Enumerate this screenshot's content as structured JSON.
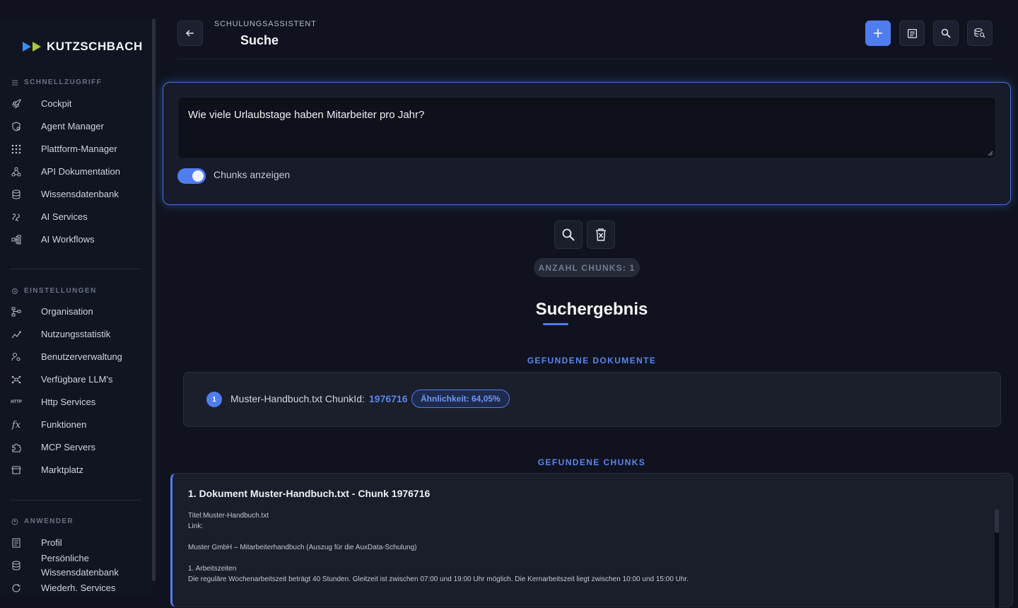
{
  "brand": {
    "name": "KUTZSCHBACH",
    "colors": {
      "accent": "#4f7df0",
      "logo_blue": "#3b8df0",
      "logo_green": "#a9c93a"
    }
  },
  "sidebar": {
    "sections": [
      {
        "title": "SCHNELLZUGRIFF",
        "icon": "menu-icon",
        "items": [
          {
            "label": "Cockpit",
            "icon": "rocket-icon"
          },
          {
            "label": "Agent Manager",
            "icon": "agent-icon"
          },
          {
            "label": "Plattform-Manager",
            "icon": "grid-icon"
          },
          {
            "label": "API Dokumentation",
            "icon": "webhook-icon"
          },
          {
            "label": "Wissensdatenbank",
            "icon": "database-icon"
          },
          {
            "label": "AI Services",
            "icon": "ai-icon"
          },
          {
            "label": "AI Workflows",
            "icon": "workflow-icon"
          }
        ]
      },
      {
        "title": "EINSTELLUNGEN",
        "icon": "settings-icon",
        "items": [
          {
            "label": "Organisation",
            "icon": "org-icon"
          },
          {
            "label": "Nutzungsstatistik",
            "icon": "stats-icon"
          },
          {
            "label": "Benutzerverwaltung",
            "icon": "user-settings-icon"
          },
          {
            "label": "Verfügbare LLM's",
            "icon": "llm-icon"
          },
          {
            "label": "Http Services",
            "icon": "http-icon"
          },
          {
            "label": "Funktionen",
            "icon": "function-icon"
          },
          {
            "label": "MCP Servers",
            "icon": "puzzle-icon"
          },
          {
            "label": "Marktplatz",
            "icon": "store-icon"
          }
        ]
      },
      {
        "title": "ANWENDER",
        "icon": "user-circle-icon",
        "items": [
          {
            "label": "Profil",
            "icon": "profile-icon"
          },
          {
            "label": "Persönliche Wissensdatenbank",
            "label_line1": "Persönliche",
            "label_line2": "Wissensdatenbank",
            "icon": "database-icon"
          },
          {
            "label": "Wiederh. Services",
            "icon": "refresh-icon"
          }
        ]
      }
    ]
  },
  "header": {
    "subtitle": "SCHULUNGSASSISTENT",
    "title": "Suche",
    "icons": [
      "back-arrow-icon",
      "plus-icon",
      "document-icon",
      "search-icon",
      "database-search-icon"
    ]
  },
  "query": {
    "text": "Wie viele Urlaubstage haben Mitarbeiter pro Jahr?",
    "toggle_label": "Chunks anzeigen",
    "toggle_on": true
  },
  "actions": {
    "icons": [
      "search-icon",
      "trash-icon"
    ]
  },
  "results": {
    "chunk_count_label": "ANZAHL CHUNKS: 1",
    "title": "Suchergebnis",
    "documents_label": "GEFUNDENE DOKUMENTE",
    "documents": [
      {
        "number": "1",
        "name": "Muster-Handbuch.txt ChunkId:",
        "chunk_id": "1976716",
        "similarity": "Ähnlichkeit: 64,05%"
      }
    ],
    "chunks_label": "GEFUNDENE CHUNKS",
    "chunks": [
      {
        "title": "1. Dokument Muster-Handbuch.txt - Chunk 1976716",
        "lines": [
          "Titel:Muster-Handbuch.txt",
          "Link:",
          "",
          "Muster GmbH – Mitarbeiterhandbuch (Auszug für die AuxData-Schulung)",
          "",
          "1. Arbeitszeiten",
          "Die reguläre Wochenarbeitszeit beträgt 40 Stunden. Gleitzeit ist zwischen 07:00 und 19:00 Uhr möglich. Die Kernarbeitszeit liegt zwischen 10:00 und 15:00 Uhr."
        ]
      }
    ]
  }
}
